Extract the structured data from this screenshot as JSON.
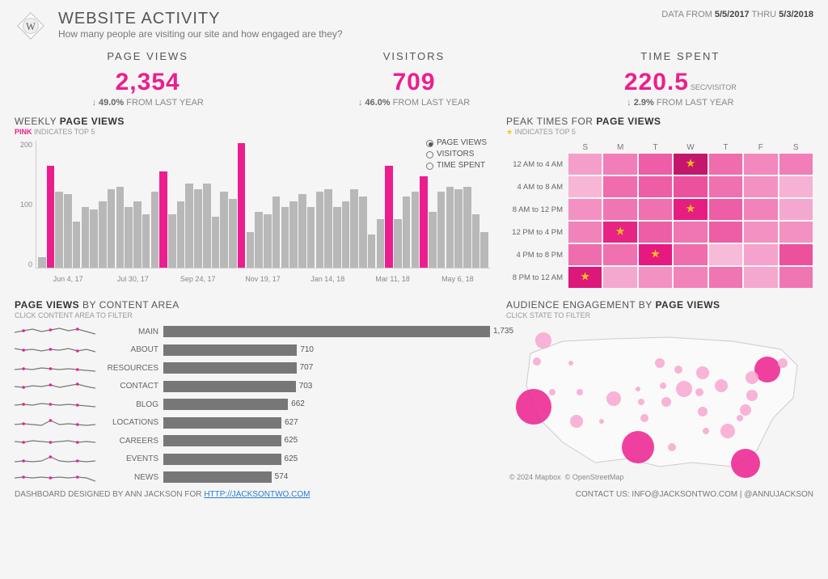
{
  "header": {
    "title": "WEBSITE ACTIVITY",
    "subtitle": "How many people are visiting our site and how engaged are they?",
    "date_from_label": "DATA FROM",
    "date_from": "5/5/2017",
    "date_thru_label": "THRU",
    "date_thru": "5/3/2018"
  },
  "kpis": {
    "page_views": {
      "label": "PAGE VIEWS",
      "value": "2,354",
      "delta_pct": "49.0%",
      "delta_text": "FROM LAST YEAR",
      "arrow": "↓"
    },
    "visitors": {
      "label": "VISITORS",
      "value": "709",
      "delta_pct": "46.0%",
      "delta_text": "FROM LAST YEAR",
      "arrow": "↓"
    },
    "time_spent": {
      "label": "TIME SPENT",
      "value": "220.5",
      "unit": "SEC/VISITOR",
      "delta_pct": "2.9%",
      "delta_text": "FROM LAST YEAR",
      "arrow": "↓"
    }
  },
  "weekly": {
    "title_prefix": "WEEKLY ",
    "title_bold": "PAGE VIEWS",
    "sub_pink": "PINK",
    "sub_rest": " INDICATES TOP 5",
    "legend": {
      "page_views": "PAGE VIEWS",
      "visitors": "VISITORS",
      "time_spent": "TIME SPENT"
    },
    "y_ticks": [
      "200",
      "100",
      "0"
    ],
    "x_ticks": [
      "Jun 4, 17",
      "Jul 30, 17",
      "Sep 24, 17",
      "Nov 19, 17",
      "Jan 14, 18",
      "Mar 11, 18",
      "May 6, 18"
    ]
  },
  "peak": {
    "title_prefix": "PEAK TIMES FOR ",
    "title_bold": "PAGE VIEWS",
    "sub_star": "★",
    "sub_rest": " INDICATES TOP 5",
    "days": [
      "S",
      "M",
      "T",
      "W",
      "T",
      "F",
      "S"
    ],
    "rows": [
      "12 AM to 4 AM",
      "4 AM to 8 AM",
      "8 AM to 12 PM",
      "12 PM to 4 PM",
      "4 PM to 8 PM",
      "8 PM to 12 AM"
    ]
  },
  "content": {
    "title_prefix": "PAGE VIEWS ",
    "title_rest": "BY CONTENT AREA",
    "sub": "CLICK CONTENT AREA TO FILTER"
  },
  "map": {
    "title_prefix": "AUDIENCE ENGAGEMENT BY ",
    "title_bold": "PAGE VIEWS",
    "sub": "CLICK STATE TO FILTER",
    "attrib1": "© 2024 Mapbox",
    "attrib2": "© OpenStreetMap"
  },
  "footer": {
    "left_pre": "DASHBOARD DESIGNED BY ANN JACKSON FOR ",
    "left_link": "HTTP://JACKSONTWO.COM",
    "right": "CONTACT US: INFO@JACKSONTWO.COM | @ANNUJACKSON"
  },
  "chart_data": {
    "weekly_page_views": {
      "type": "bar",
      "ylabel": "Page Views",
      "ylim": [
        0,
        250
      ],
      "x_start": "2017-05-07",
      "x_end": "2018-05-06",
      "values": [
        20,
        200,
        150,
        145,
        90,
        120,
        115,
        130,
        155,
        160,
        120,
        130,
        105,
        150,
        190,
        105,
        130,
        165,
        155,
        165,
        100,
        150,
        135,
        245,
        70,
        110,
        105,
        140,
        120,
        130,
        145,
        120,
        150,
        155,
        120,
        130,
        155,
        140,
        65,
        95,
        200,
        95,
        140,
        150,
        180,
        110,
        150,
        160,
        155,
        160,
        105,
        70
      ],
      "top5_indices": [
        1,
        14,
        23,
        40,
        44
      ]
    },
    "page_views_by_content": {
      "type": "bar",
      "orientation": "horizontal",
      "categories": [
        "MAIN",
        "ABOUT",
        "RESOURCES",
        "CONTACT",
        "BLOG",
        "LOCATIONS",
        "CAREERS",
        "EVENTS",
        "NEWS"
      ],
      "values": [
        1735,
        710,
        707,
        703,
        662,
        627,
        625,
        625,
        574
      ]
    },
    "peak_heatmap": {
      "type": "heatmap",
      "x": [
        "S",
        "M",
        "T",
        "W",
        "T",
        "F",
        "S"
      ],
      "y": [
        "12 AM to 4 AM",
        "4 AM to 8 AM",
        "8 AM to 12 PM",
        "12 PM to 4 PM",
        "4 PM to 8 PM",
        "8 PM to 12 AM"
      ],
      "intensity": [
        [
          0.3,
          0.42,
          0.55,
          0.95,
          0.5,
          0.38,
          0.42
        ],
        [
          0.2,
          0.5,
          0.55,
          0.6,
          0.48,
          0.35,
          0.22
        ],
        [
          0.35,
          0.45,
          0.48,
          0.8,
          0.55,
          0.4,
          0.25
        ],
        [
          0.4,
          0.78,
          0.55,
          0.45,
          0.55,
          0.35,
          0.35
        ],
        [
          0.5,
          0.48,
          0.82,
          0.5,
          0.18,
          0.28,
          0.6
        ],
        [
          0.85,
          0.25,
          0.35,
          0.4,
          0.45,
          0.25,
          0.45
        ]
      ],
      "top5_cells": [
        [
          0,
          3
        ],
        [
          2,
          3
        ],
        [
          3,
          1
        ],
        [
          4,
          2
        ],
        [
          5,
          0
        ]
      ]
    },
    "map_bubbles": {
      "type": "scatter",
      "note": "approximate relative sizes of page-view bubbles by state; coords are % within US map box",
      "points": [
        {
          "state": "CA",
          "x": 9,
          "y": 53,
          "r": 22,
          "big": true
        },
        {
          "state": "TX",
          "x": 43,
          "y": 78,
          "r": 20,
          "big": true
        },
        {
          "state": "FL",
          "x": 78,
          "y": 88,
          "r": 18,
          "big": true
        },
        {
          "state": "NY",
          "x": 85,
          "y": 30,
          "r": 16,
          "big": true
        },
        {
          "state": "WA",
          "x": 12,
          "y": 12,
          "r": 10,
          "big": false
        },
        {
          "state": "CO",
          "x": 35,
          "y": 48,
          "r": 9,
          "big": false
        },
        {
          "state": "IL",
          "x": 58,
          "y": 42,
          "r": 10,
          "big": false
        },
        {
          "state": "GA",
          "x": 72,
          "y": 68,
          "r": 9,
          "big": false
        },
        {
          "state": "OH",
          "x": 70,
          "y": 40,
          "r": 8,
          "big": false
        },
        {
          "state": "PA",
          "x": 80,
          "y": 35,
          "r": 8,
          "big": false
        },
        {
          "state": "MI",
          "x": 64,
          "y": 32,
          "r": 8,
          "big": false
        },
        {
          "state": "NC",
          "x": 78,
          "y": 55,
          "r": 7,
          "big": false
        },
        {
          "state": "AZ",
          "x": 23,
          "y": 62,
          "r": 8,
          "big": false
        },
        {
          "state": "VA",
          "x": 80,
          "y": 46,
          "r": 7,
          "big": false
        },
        {
          "state": "MN",
          "x": 50,
          "y": 26,
          "r": 6,
          "big": false
        },
        {
          "state": "MO",
          "x": 52,
          "y": 50,
          "r": 6,
          "big": false
        },
        {
          "state": "TN",
          "x": 64,
          "y": 56,
          "r": 6,
          "big": false
        },
        {
          "state": "MA",
          "x": 90,
          "y": 26,
          "r": 6,
          "big": false
        },
        {
          "state": "OR",
          "x": 10,
          "y": 25,
          "r": 5,
          "big": false
        },
        {
          "state": "WI",
          "x": 56,
          "y": 30,
          "r": 5,
          "big": false
        },
        {
          "state": "OK",
          "x": 45,
          "y": 60,
          "r": 5,
          "big": false
        },
        {
          "state": "IN",
          "x": 63,
          "y": 44,
          "r": 5,
          "big": false
        },
        {
          "state": "LA",
          "x": 54,
          "y": 78,
          "r": 5,
          "big": false
        },
        {
          "state": "KS",
          "x": 44,
          "y": 50,
          "r": 4,
          "big": false
        },
        {
          "state": "UT",
          "x": 24,
          "y": 44,
          "r": 4,
          "big": false
        },
        {
          "state": "NV",
          "x": 15,
          "y": 44,
          "r": 4,
          "big": false
        },
        {
          "state": "AL",
          "x": 65,
          "y": 68,
          "r": 4,
          "big": false
        },
        {
          "state": "SC",
          "x": 76,
          "y": 60,
          "r": 4,
          "big": false
        },
        {
          "state": "IA",
          "x": 51,
          "y": 40,
          "r": 4,
          "big": false
        },
        {
          "state": "NM",
          "x": 31,
          "y": 62,
          "r": 3,
          "big": false
        },
        {
          "state": "ID",
          "x": 21,
          "y": 26,
          "r": 3,
          "big": false
        },
        {
          "state": "NE",
          "x": 43,
          "y": 42,
          "r": 3,
          "big": false
        }
      ]
    }
  }
}
